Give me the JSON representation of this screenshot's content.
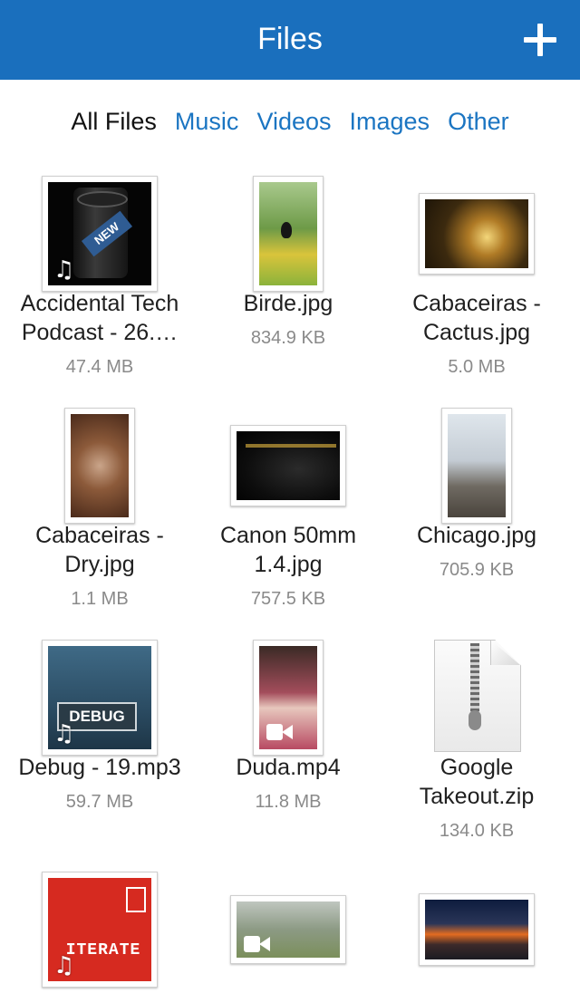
{
  "header": {
    "title": "Files"
  },
  "filters": [
    {
      "label": "All Files"
    },
    {
      "label": "Music"
    },
    {
      "label": "Videos"
    },
    {
      "label": "Images"
    },
    {
      "label": "Other"
    }
  ],
  "files": [
    {
      "name": "Accidental Tech Podcast - 26.…",
      "size": "47.4 MB",
      "kind": "audio",
      "badge_text": "NEW"
    },
    {
      "name": "Birde.jpg",
      "size": "834.9 KB",
      "kind": "image"
    },
    {
      "name": "Cabaceiras - Cactus.jpg",
      "size": "5.0 MB",
      "kind": "image"
    },
    {
      "name": "Cabaceiras - Dry.jpg",
      "size": "1.1 MB",
      "kind": "image"
    },
    {
      "name": "Canon 50mm 1.4.jpg",
      "size": "757.5 KB",
      "kind": "image"
    },
    {
      "name": "Chicago.jpg",
      "size": "705.9 KB",
      "kind": "image"
    },
    {
      "name": "Debug - 19.mp3",
      "size": "59.7 MB",
      "kind": "audio",
      "badge_text": "DEBUG"
    },
    {
      "name": "Duda.mp4",
      "size": "11.8 MB",
      "kind": "video"
    },
    {
      "name": "Google Takeout.zip",
      "size": "134.0 KB",
      "kind": "zip"
    },
    {
      "name": "",
      "size": "",
      "kind": "audio",
      "badge_text": "ITERATE"
    },
    {
      "name": "",
      "size": "",
      "kind": "video"
    },
    {
      "name": "",
      "size": "",
      "kind": "image"
    }
  ],
  "icons": {
    "add": "plus-icon",
    "audio": "music-note-icon",
    "video": "video-camera-icon",
    "zip": "zip-file-icon"
  },
  "colors": {
    "navbar": "#1a6fbd",
    "tab_link": "#1b75c2",
    "tab_active": "#111111",
    "size_text": "#8a8a8a"
  }
}
